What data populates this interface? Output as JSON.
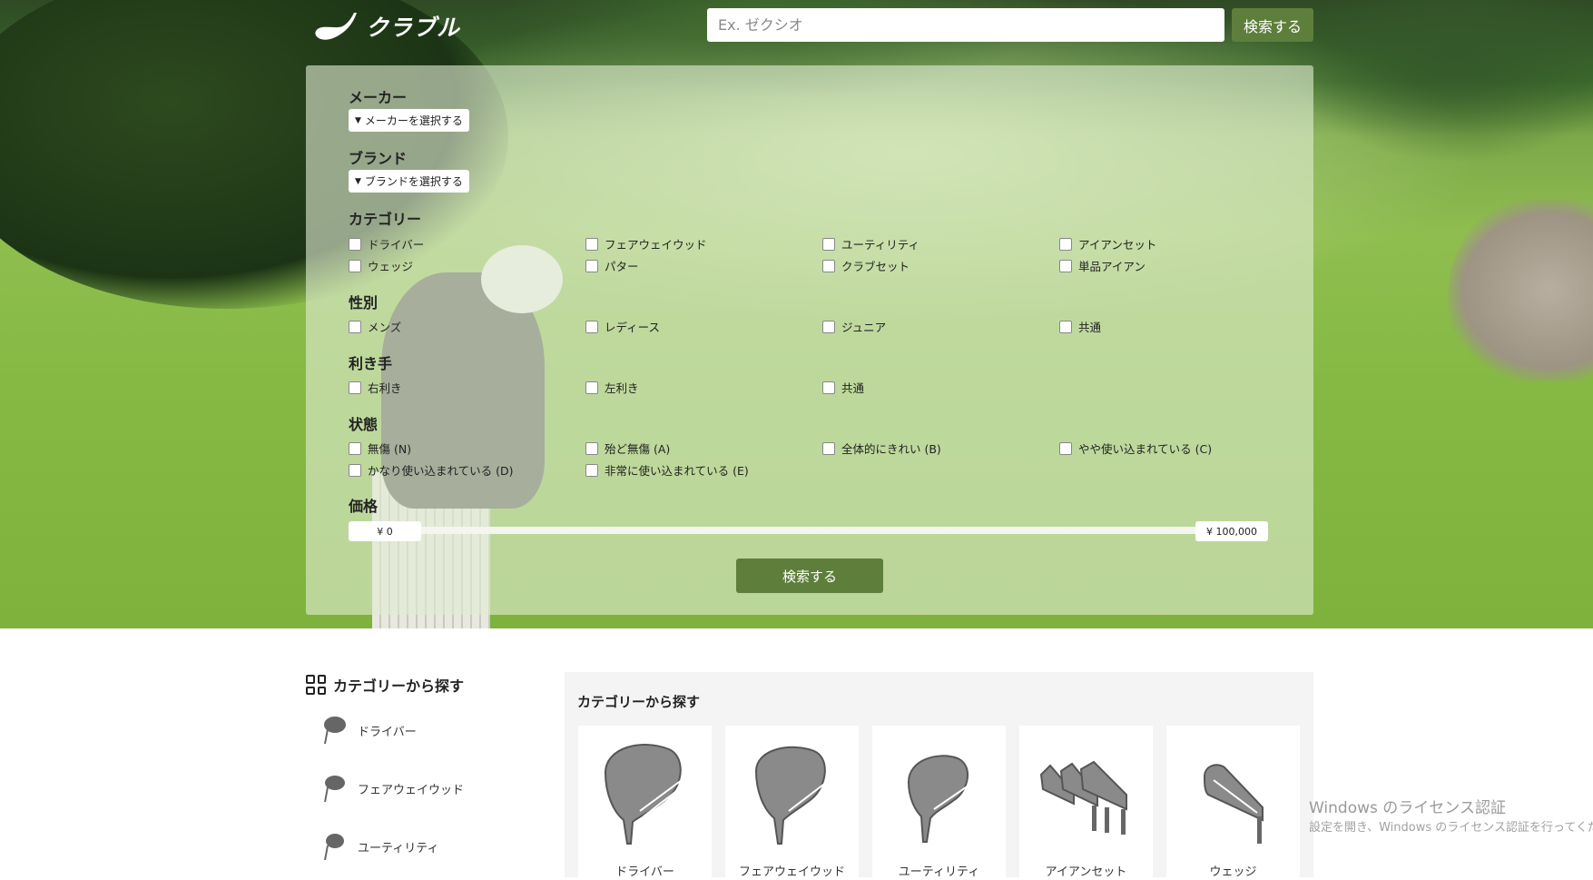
{
  "header": {
    "logo_text": "クラブル",
    "search_placeholder": "Ex. ゼクシオ",
    "search_button": "検索する"
  },
  "filter": {
    "maker": {
      "title": "メーカー",
      "dropdown": "メーカーを選択する"
    },
    "brand": {
      "title": "ブランド",
      "dropdown": "ブランドを選択する"
    },
    "category": {
      "title": "カテゴリー",
      "options": [
        "ドライバー",
        "フェアウェイウッド",
        "ユーティリティ",
        "アイアンセット",
        "ウェッジ",
        "パター",
        "クラブセット",
        "単品アイアン"
      ]
    },
    "gender": {
      "title": "性別",
      "options": [
        "メンズ",
        "レディース",
        "ジュニア",
        "共通"
      ]
    },
    "hand": {
      "title": "利き手",
      "options": [
        "右利き",
        "左利き",
        "共通"
      ]
    },
    "condition": {
      "title": "状態",
      "options": [
        "無傷 (N)",
        "殆ど無傷 (A)",
        "全体的にきれい (B)",
        "やや使い込まれている (C)",
        "かなり使い込まれている (D)",
        "非常に使い込まれている (E)"
      ]
    },
    "price": {
      "title": "価格",
      "min": "¥ 0",
      "max": "¥ 100,000"
    },
    "submit": "検索する"
  },
  "sidebar": {
    "title": "カテゴリーから探す",
    "items": [
      "ドライバー",
      "フェアウェイウッド",
      "ユーティリティ"
    ]
  },
  "categories": {
    "heading": "カテゴリーから探す",
    "cards": [
      "ドライバー",
      "フェアウェイウッド",
      "ユーティリティ",
      "アイアンセット",
      "ウェッジ"
    ]
  },
  "watermark": {
    "title": "Windows のライセンス認証",
    "sub": "設定を開き、Windows のライセンス認証を行ってくださ"
  },
  "colors": {
    "accent": "#5e7e3c",
    "panel": "#e1ecd2"
  }
}
